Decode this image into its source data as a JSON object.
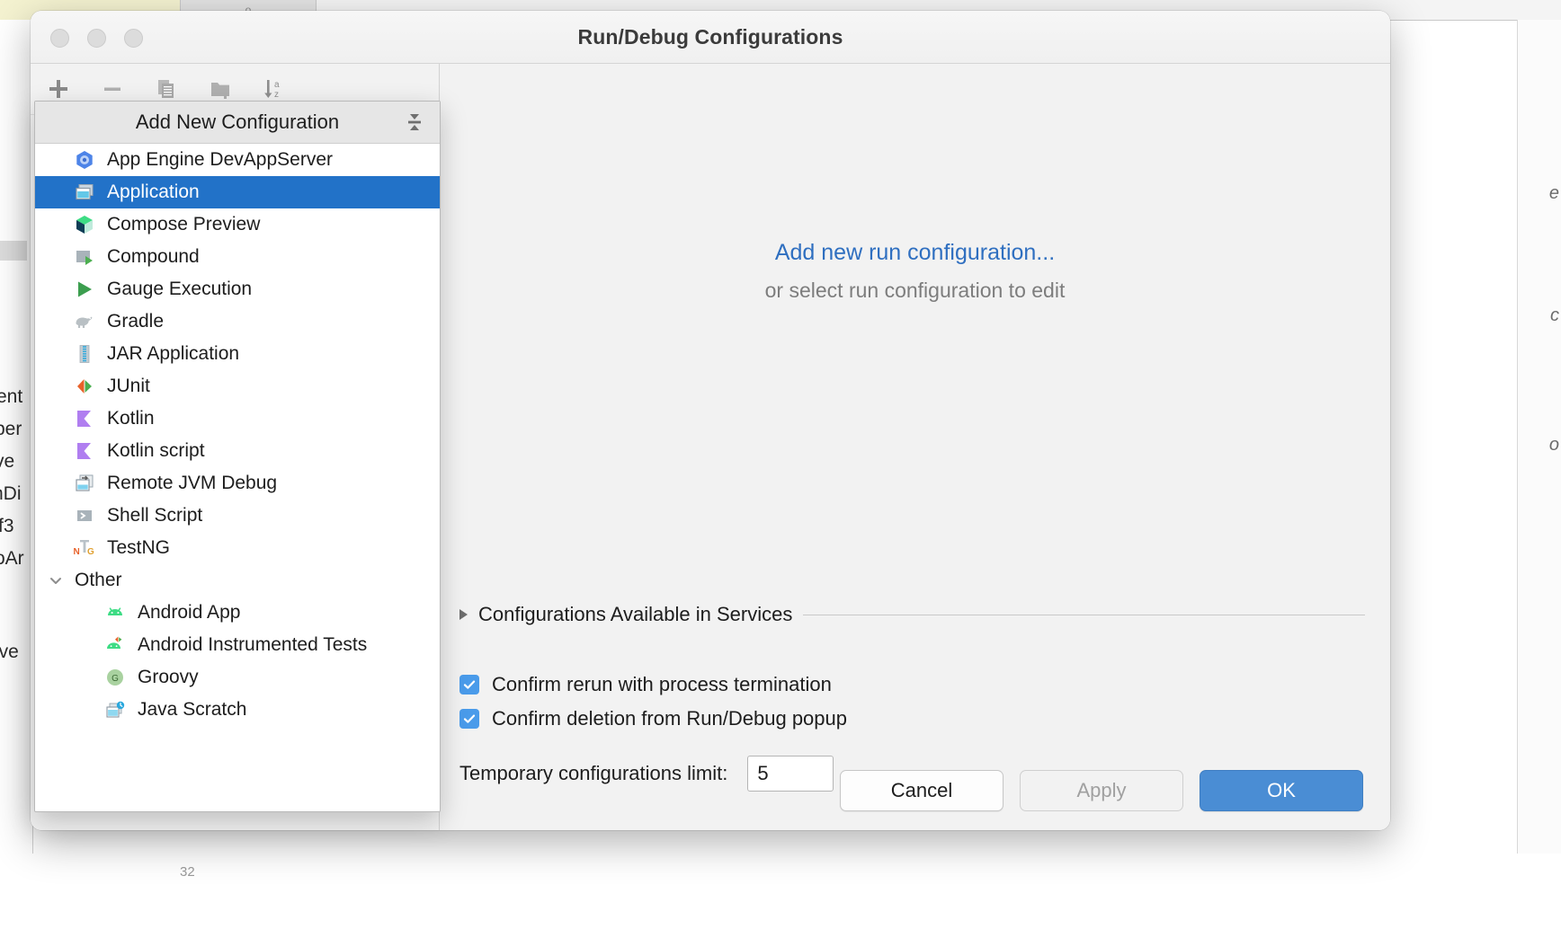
{
  "window": {
    "title": "Run/Debug Configurations",
    "traffic_lights": [
      "close",
      "minimize",
      "zoom"
    ]
  },
  "toolbar": {
    "buttons": [
      {
        "name": "add",
        "icon": "plus-icon"
      },
      {
        "name": "remove",
        "icon": "minus-icon"
      },
      {
        "name": "copy",
        "icon": "copy-icon"
      },
      {
        "name": "new-folder",
        "icon": "new-folder-icon"
      },
      {
        "name": "sort-alphabetically",
        "icon": "sort-az-icon"
      }
    ]
  },
  "popup": {
    "header": "Add New Configuration",
    "collapse_icon": "collapse-all-icon",
    "items": [
      {
        "label": "App Engine DevAppServer",
        "icon": "app-engine-icon",
        "selected": false,
        "level": 0
      },
      {
        "label": "Application",
        "icon": "application-icon",
        "selected": true,
        "level": 0
      },
      {
        "label": "Compose Preview",
        "icon": "compose-preview-icon",
        "selected": false,
        "level": 0
      },
      {
        "label": "Compound",
        "icon": "compound-icon",
        "selected": false,
        "level": 0
      },
      {
        "label": "Gauge Execution",
        "icon": "gauge-run-icon",
        "selected": false,
        "level": 0
      },
      {
        "label": "Gradle",
        "icon": "gradle-elephant-icon",
        "selected": false,
        "level": 0
      },
      {
        "label": "JAR Application",
        "icon": "jar-icon",
        "selected": false,
        "level": 0
      },
      {
        "label": "JUnit",
        "icon": "junit-icon",
        "selected": false,
        "level": 0
      },
      {
        "label": "Kotlin",
        "icon": "kotlin-icon",
        "selected": false,
        "level": 0
      },
      {
        "label": "Kotlin script",
        "icon": "kotlin-icon",
        "selected": false,
        "level": 0
      },
      {
        "label": "Remote JVM Debug",
        "icon": "remote-debug-icon",
        "selected": false,
        "level": 0
      },
      {
        "label": "Shell Script",
        "icon": "shell-script-icon",
        "selected": false,
        "level": 0
      },
      {
        "label": "TestNG",
        "icon": "testng-icon",
        "selected": false,
        "level": 0
      }
    ],
    "group": {
      "label": "Other",
      "expanded": true,
      "chevron": "chevron-down-icon",
      "children": [
        {
          "label": "Android App",
          "icon": "android-icon"
        },
        {
          "label": "Android Instrumented Tests",
          "icon": "android-test-icon"
        },
        {
          "label": "Groovy",
          "icon": "groovy-icon"
        },
        {
          "label": "Java Scratch",
          "icon": "java-scratch-icon"
        }
      ]
    }
  },
  "main": {
    "placeholder_link": "Add new run configuration...",
    "placeholder_sub": "or select run configuration to edit",
    "collapsible_section": {
      "label": "Configurations Available in Services",
      "expanded": false,
      "arrow": "triangle-right-icon"
    },
    "checkboxes": [
      {
        "label": "Confirm rerun with process termination",
        "checked": true
      },
      {
        "label": "Confirm deletion from Run/Debug popup",
        "checked": true
      }
    ],
    "limit": {
      "label": "Temporary configurations limit:",
      "value": "5"
    }
  },
  "footer": {
    "cancel": "Cancel",
    "apply": "Apply",
    "ok": "OK"
  },
  "background": {
    "tab_glyph": "o",
    "left_fragments": [
      "ent",
      "ber",
      "ve",
      "nDi",
      "f3",
      "oAr",
      "ive"
    ],
    "right_fragments": [
      "e",
      "c",
      "o"
    ],
    "bottom_number": "32"
  },
  "colors": {
    "selection_blue": "#2272c8",
    "link_blue": "#2f6fc0",
    "ok_button_blue": "#4a8dd4",
    "checkbox_blue": "#4a9bea",
    "title_text": "#3b3b3b"
  }
}
